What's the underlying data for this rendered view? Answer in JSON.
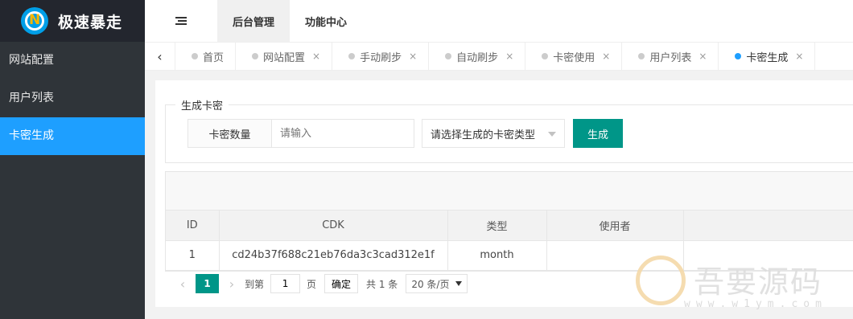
{
  "app": {
    "title": "极速暴走",
    "brand_color": "#1e9fff",
    "accent_color": "#009688"
  },
  "header": {
    "tabs": [
      {
        "label": "后台管理"
      },
      {
        "label": "功能中心"
      }
    ]
  },
  "sidebar": {
    "items": [
      {
        "label": "网站配置"
      },
      {
        "label": "用户列表"
      },
      {
        "label": "卡密生成"
      }
    ],
    "active": "卡密生成"
  },
  "tabbar": {
    "tabs": [
      {
        "label": "首页"
      },
      {
        "label": "网站配置",
        "close": "×"
      },
      {
        "label": "手动刷步",
        "close": "×"
      },
      {
        "label": "自动刷步",
        "close": "×"
      },
      {
        "label": "卡密使用",
        "close": "×"
      },
      {
        "label": "用户列表",
        "close": "×"
      },
      {
        "label": "卡密生成",
        "close": "×"
      }
    ],
    "active": "卡密生成"
  },
  "generator": {
    "legend": "生成卡密",
    "quantity_label": "卡密数量",
    "quantity_placeholder": "请输入",
    "type_select": "请选择生成的卡密类型",
    "submit_label": "生成"
  },
  "table": {
    "columns": [
      "ID",
      "CDK",
      "类型",
      "使用者",
      ""
    ],
    "rows": [
      {
        "id": "1",
        "cdk": "cd24b37f688c21eb76da3c3cad312e1f",
        "type": "month",
        "user": "",
        "extra": ""
      }
    ]
  },
  "pagination": {
    "prev": "‹",
    "current": "1",
    "next": "›",
    "goto_label": "到第",
    "goto_value": "1",
    "page_unit": "页",
    "ok_label": "确定",
    "total": "共 1 条",
    "page_size": "20 条/页"
  },
  "watermark": {
    "text": "吾要源码",
    "url": "www.w1ym.com"
  }
}
